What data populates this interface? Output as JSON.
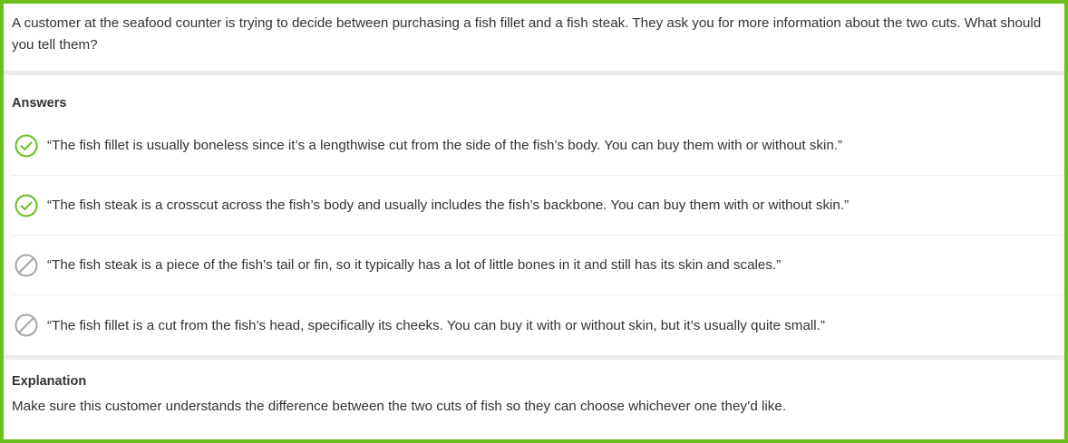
{
  "question": {
    "text": "A customer at the seafood counter is trying to decide between purchasing a fish fillet and a fish steak. They ask you for more information about the two cuts. What should you tell them?"
  },
  "answers": {
    "title": "Answers",
    "items": [
      {
        "text": "“The fish fillet is usually boneless since it’s a lengthwise cut from the side of the fish’s body. You can buy them with or without skin.”",
        "status": "correct",
        "icon": "check-circle-icon"
      },
      {
        "text": "“The fish steak is a crosscut across the fish’s body and usually includes the fish’s backbone. You can buy them with or without skin.”",
        "status": "correct",
        "icon": "check-circle-icon"
      },
      {
        "text": "“The fish steak is a piece of the fish’s tail or fin, so it typically has a lot of little bones in it and still has its skin and scales.”",
        "status": "incorrect",
        "icon": "prohibited-circle-icon"
      },
      {
        "text": "“The fish fillet is a cut from the fish’s head, specifically its cheeks. You can buy it with or without skin, but it’s usually quite small.”",
        "status": "incorrect",
        "icon": "prohibited-circle-icon"
      }
    ]
  },
  "explanation": {
    "title": "Explanation",
    "text": "Make sure this customer understands the difference between the two cuts of fish so they can choose whichever one they’d like."
  },
  "colors": {
    "frame_border": "#6cbf1f",
    "correct_icon": "#6cbf1f",
    "incorrect_icon": "#a6a6a6",
    "divider": "#ececec",
    "text": "#333333"
  }
}
